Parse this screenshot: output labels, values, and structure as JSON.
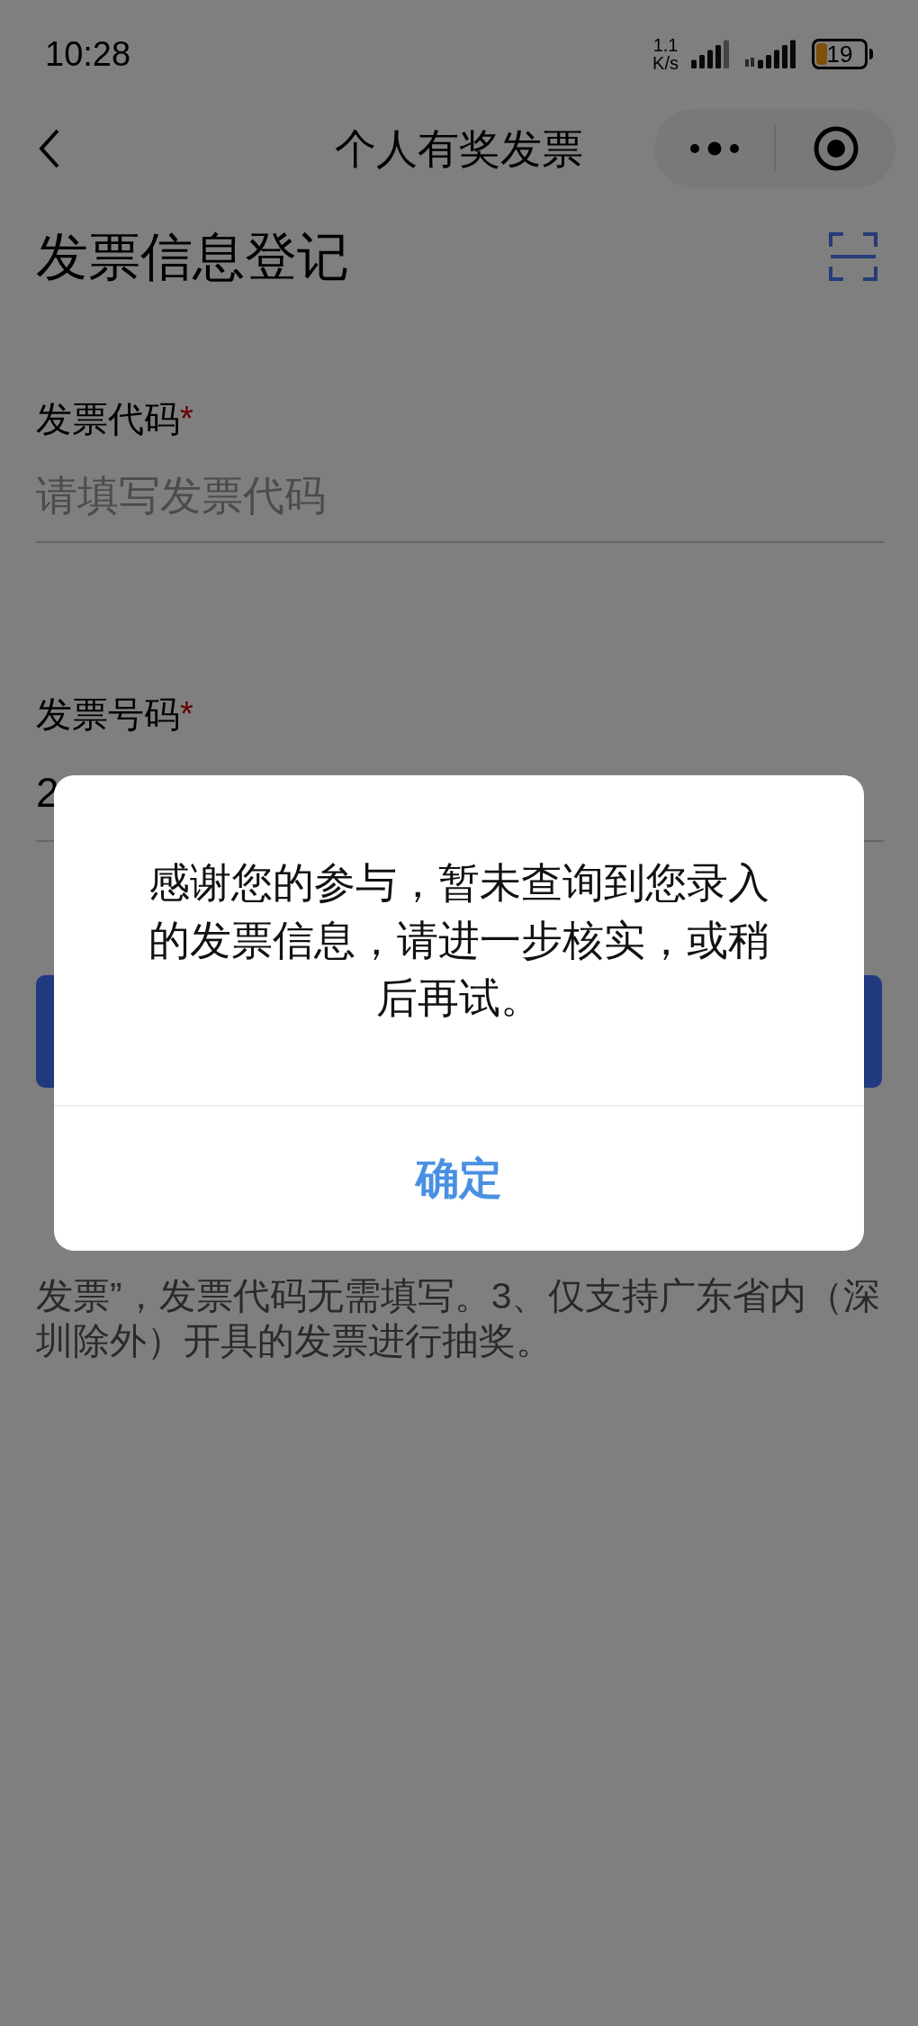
{
  "status_bar": {
    "time": "10:28",
    "speed_value": "1.1",
    "speed_unit": "K/s",
    "battery": "19"
  },
  "nav": {
    "title": "个人有奖发票"
  },
  "page": {
    "heading": "发票信息登记"
  },
  "fields": [
    {
      "label": "发票代码",
      "required_mark": "*",
      "placeholder": "请填写发票代码"
    },
    {
      "label": "发票号码",
      "required_mark": "*",
      "value": "2"
    }
  ],
  "notes": {
    "text": "发票”，发票代码无需填写。3、仅支持广东省内（深圳除外）开具的发票进行抽奖。"
  },
  "dialog": {
    "message": "感谢您的参与，暂未查询到您录入的发票信息，请进一步核实，或稍后再试。",
    "confirm_button": "确定"
  }
}
